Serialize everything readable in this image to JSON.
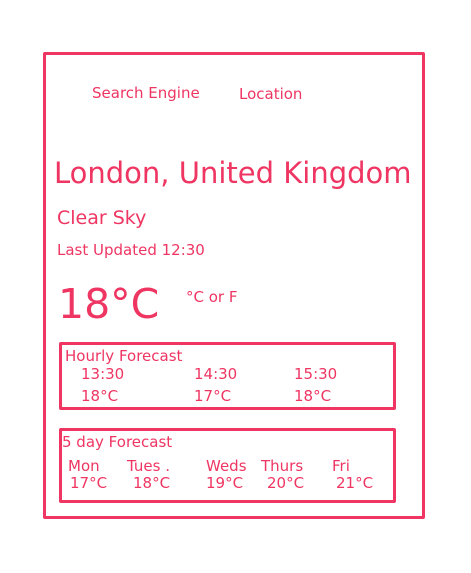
{
  "nav": {
    "search_engine": "Search Engine",
    "location": "Location"
  },
  "weather": {
    "city": "London, United Kingdom",
    "condition": "Clear Sky",
    "last_updated": "Last Updated 12:30",
    "temperature": "18°C",
    "unit_toggle": "°C or F"
  },
  "hourly": {
    "title": "Hourly Forecast",
    "items": [
      {
        "time": "13:30",
        "temp": "18°C"
      },
      {
        "time": "14:30",
        "temp": "17°C"
      },
      {
        "time": "15:30",
        "temp": "18°C"
      }
    ]
  },
  "daily": {
    "title": "5 day Forecast",
    "items": [
      {
        "day": "Mon",
        "temp": "17°C"
      },
      {
        "day": "Tues .",
        "temp": "18°C"
      },
      {
        "day": "Weds",
        "temp": "19°C"
      },
      {
        "day": "Thurs",
        "temp": "20°C"
      },
      {
        "day": "Fri",
        "temp": "21°C"
      }
    ]
  },
  "colors": {
    "accent": "#ef3562",
    "background": "#ffffff"
  }
}
